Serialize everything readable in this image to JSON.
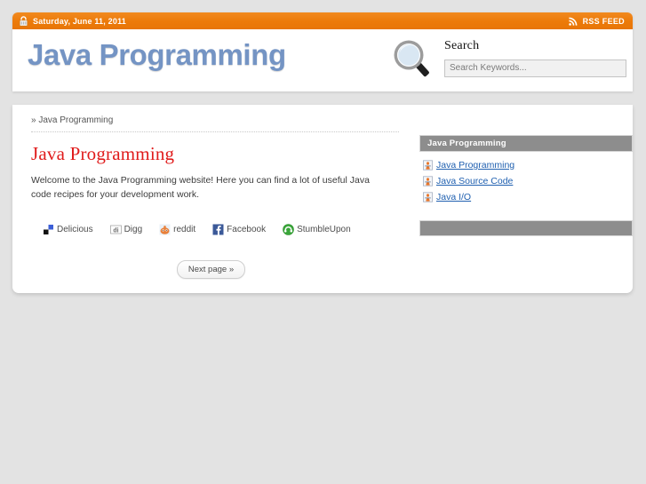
{
  "topbar": {
    "lock_icon": "lock-icon",
    "date": "Saturday, June 11, 2011",
    "rss_icon": "rss-icon",
    "rss_label": "RSS FEED"
  },
  "header": {
    "logo": "Java Programming",
    "search": {
      "magnifier_icon": "magnifier-icon",
      "title": "Search",
      "placeholder": "Search Keywords...",
      "value": ""
    }
  },
  "main": {
    "breadcrumb": "» Java Programming",
    "title": "Java Programming",
    "intro": "Welcome to the Java Programming website! Here you can find a lot of useful Java code recipes for your development work.",
    "share": [
      {
        "icon": "delicious-icon",
        "label": "Delicious"
      },
      {
        "icon": "digg-icon",
        "label": "Digg"
      },
      {
        "icon": "reddit-icon",
        "label": "reddit"
      },
      {
        "icon": "facebook-icon",
        "label": "Facebook"
      },
      {
        "icon": "stumbleupon-icon",
        "label": "StumbleUpon"
      }
    ],
    "next_page": "Next page »"
  },
  "sidebar": {
    "widget_title": "Java Programming",
    "links": [
      {
        "icon": "java-duke-icon",
        "label": "Java Programming"
      },
      {
        "icon": "java-duke-icon",
        "label": "Java Source Code"
      },
      {
        "icon": "java-duke-icon",
        "label": "Java I/O"
      }
    ],
    "second_widget_title": ""
  },
  "colors": {
    "topbar_orange": "#ec7a09",
    "logo_blue": "#7494c4",
    "title_red": "#e01b1b",
    "link_blue": "#2060b0",
    "widget_gray": "#8d8d8d",
    "page_bg": "#e3e3e3"
  }
}
